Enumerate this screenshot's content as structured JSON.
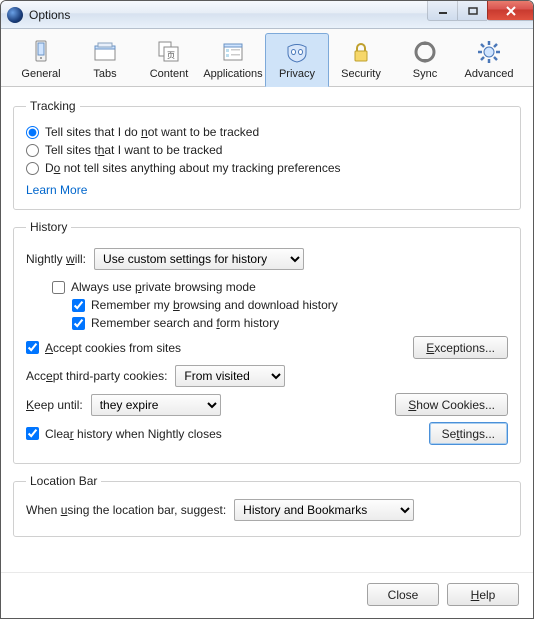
{
  "window": {
    "title": "Options"
  },
  "toolbar": {
    "items": [
      {
        "label": "General"
      },
      {
        "label": "Tabs"
      },
      {
        "label": "Content"
      },
      {
        "label": "Applications"
      },
      {
        "label": "Privacy"
      },
      {
        "label": "Security"
      },
      {
        "label": "Sync"
      },
      {
        "label": "Advanced"
      }
    ],
    "selected": "Privacy"
  },
  "tracking": {
    "legend": "Tracking",
    "opt_do_not_track_pre": "Tell sites that I do ",
    "opt_do_not_track_u": "n",
    "opt_do_not_track_post": "ot want to be tracked",
    "opt_want_tracked_pre": "Tell sites t",
    "opt_want_tracked_u": "h",
    "opt_want_tracked_post": "at I want to be tracked",
    "opt_silent_pre": "D",
    "opt_silent_u": "o",
    "opt_silent_post": " not tell sites anything about my tracking preferences",
    "learn_more": "Learn More"
  },
  "history": {
    "legend": "History",
    "will_pre": "Nightly ",
    "will_u": "w",
    "will_post": "ill:",
    "mode_options": [
      "Use custom settings for history"
    ],
    "mode_value": "Use custom settings for history",
    "private_pre": "Always use ",
    "private_u": "p",
    "private_post": "rivate browsing mode",
    "remember_browsing_pre": "Remember my ",
    "remember_browsing_u": "b",
    "remember_browsing_post": "rowsing and download history",
    "remember_search_pre": "Remember search and ",
    "remember_search_u": "f",
    "remember_search_post": "orm history",
    "accept_cookies_u": "A",
    "accept_cookies_post": "ccept cookies from sites",
    "exceptions_u": "E",
    "exceptions_post": "xceptions...",
    "third_party_pre": "Acc",
    "third_party_u": "e",
    "third_party_post": "pt third-party cookies:",
    "third_party_options": [
      "From visited"
    ],
    "third_party_value": "From visited",
    "keep_until_u": "K",
    "keep_until_post": "eep until:",
    "keep_until_options": [
      "they expire"
    ],
    "keep_until_value": "they expire",
    "show_cookies_u": "S",
    "show_cookies_post": "how Cookies...",
    "clear_close_pre": "Clea",
    "clear_close_u": "r",
    "clear_close_post": " history when Nightly closes",
    "settings_pre": "Se",
    "settings_u": "t",
    "settings_post": "tings..."
  },
  "locationbar": {
    "legend": "Location Bar",
    "suggest_pre": "When ",
    "suggest_u": "u",
    "suggest_post": "sing the location bar, suggest:",
    "options": [
      "History and Bookmarks"
    ],
    "value": "History and Bookmarks"
  },
  "footer": {
    "close": "Close",
    "help_u": "H",
    "help_post": "elp"
  }
}
